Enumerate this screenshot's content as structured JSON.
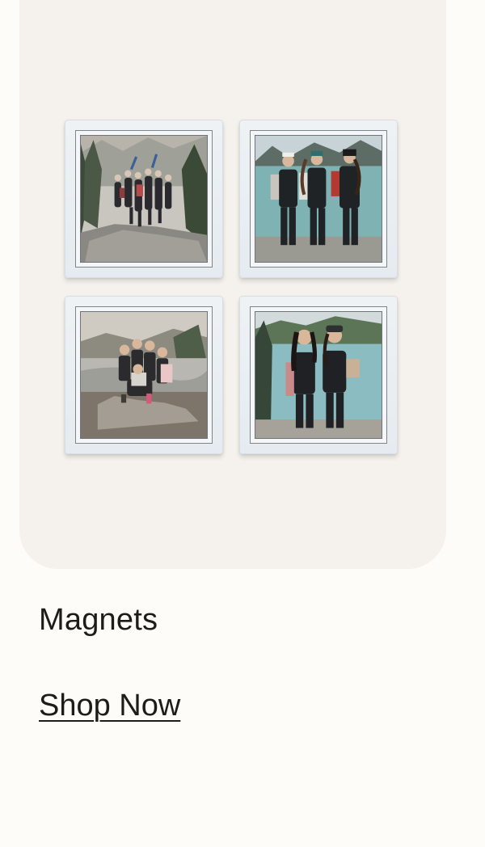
{
  "product": {
    "name": "Magnets",
    "cta_label": "Shop Now"
  },
  "colors": {
    "page_background": "#fdfcf8",
    "card_background": "#f5f1ec",
    "text": "#1d1c18",
    "magnet_surface": "#eef2f5"
  },
  "magnets": [
    {
      "scene": "group-jumping-on-rocks-forest"
    },
    {
      "scene": "three-friends-by-lake"
    },
    {
      "scene": "group-sitting-on-rocks-by-river"
    },
    {
      "scene": "two-friends-by-lake"
    }
  ]
}
